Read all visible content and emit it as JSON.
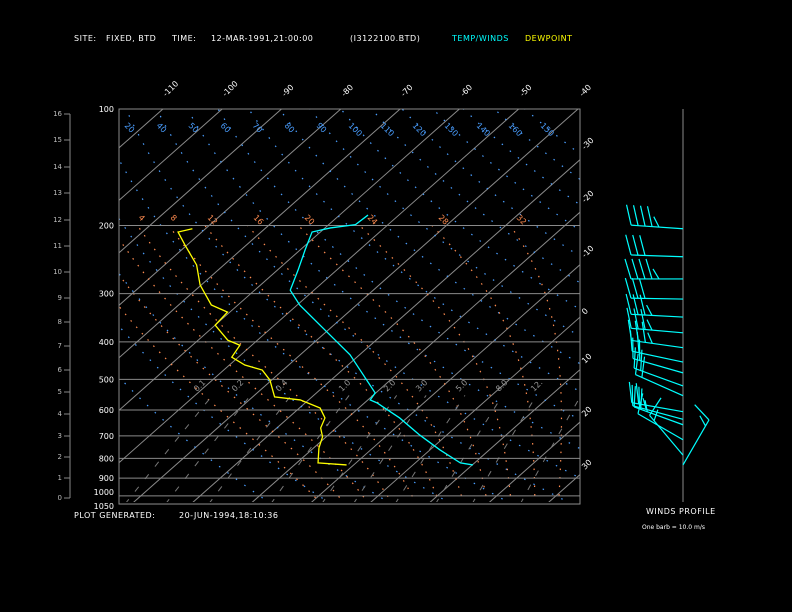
{
  "header": {
    "site_label": "SITE:",
    "site_value": "FIXED, BTD",
    "time_label": "TIME:",
    "time_value": "12-MAR-1991,21:00:00",
    "file_value": "(I3122100.BTD)",
    "legend_temp": "TEMP/WINDS",
    "legend_dew": "DEWPOINT"
  },
  "footer": {
    "generated_label": "PLOT GENERATED:",
    "generated_value": "20-JUN-1994,18:10:36"
  },
  "winds_panel": {
    "title": "WINDS PROFILE",
    "note": "One barb = 10.0 m/s"
  },
  "colors": {
    "temperature": "#00ffff",
    "dewpoint": "#ffff00",
    "dry_adiabat": "#4a9eff",
    "moist_adiabat": "#ff8c50",
    "grid": "#8a8a8a",
    "background": "#000000"
  },
  "chart_data": {
    "type": "line",
    "subtype": "skew-T log-p",
    "pressure_levels": [
      "100",
      "200",
      "300",
      "400",
      "500",
      "600",
      "700",
      "800",
      "900",
      "1000",
      "1050"
    ],
    "pressure_range_hpa": [
      100,
      1050
    ],
    "pressure_scale": "log",
    "height_km_ticks": [
      "0",
      "1",
      "2",
      "3",
      "4",
      "5",
      "6",
      "7",
      "8",
      "9",
      "10",
      "11",
      "12",
      "13",
      "14",
      "15",
      "16"
    ],
    "isotherm_top_labels": [
      "-110",
      "-100",
      "-90",
      "-80",
      "-70",
      "-60",
      "-50",
      "-40"
    ],
    "isotherm_right_labels": [
      "-30",
      "-20",
      "-10",
      "0",
      "10",
      "20",
      "30"
    ],
    "dry_adiabat_labels": [
      "20",
      "40",
      "50",
      "60",
      "70",
      "80",
      "90",
      "100",
      "110",
      "120",
      "130",
      "140",
      "160",
      "150"
    ],
    "moist_adiabat_labels": [
      "4",
      "8",
      "12",
      "16",
      "20",
      "24",
      "28",
      "32"
    ],
    "mixing_ratio_labels": [
      "0.1",
      "0.2",
      "0.4",
      "1.0",
      "2.0",
      "3.0",
      "5.0",
      "8.0",
      "12."
    ],
    "series": [
      {
        "name": "TEMP/WINDS",
        "color": "#00ffff",
        "points": [
          [
            832,
            10.1
          ],
          [
            822,
            7.6
          ],
          [
            761,
            1.7
          ],
          [
            696,
            -4.6
          ],
          [
            629,
            -11.2
          ],
          [
            575,
            -17.9
          ],
          [
            565,
            -19.6
          ],
          [
            542,
            -20.1
          ],
          [
            473,
            -27.0
          ],
          [
            432,
            -31.6
          ],
          [
            373,
            -40.5
          ],
          [
            321,
            -49.6
          ],
          [
            294,
            -54.0
          ],
          [
            261,
            -56.5
          ],
          [
            231,
            -59.2
          ],
          [
            208,
            -61.4
          ],
          [
            203,
            -59.1
          ],
          [
            199,
            -55.5
          ],
          [
            188,
            -55.2
          ]
        ]
      },
      {
        "name": "DEWPOINT",
        "color": "#ffff00",
        "points": [
          [
            832,
            -11.2
          ],
          [
            822,
            -16.4
          ],
          [
            752,
            -19.1
          ],
          [
            704,
            -20.6
          ],
          [
            668,
            -22.6
          ],
          [
            629,
            -23.8
          ],
          [
            593,
            -26.5
          ],
          [
            565,
            -31.4
          ],
          [
            555,
            -36.3
          ],
          [
            502,
            -40.3
          ],
          [
            473,
            -43.5
          ],
          [
            459,
            -47.4
          ],
          [
            438,
            -51.1
          ],
          [
            408,
            -52.0
          ],
          [
            396,
            -55.0
          ],
          [
            362,
            -60.0
          ],
          [
            335,
            -60.4
          ],
          [
            321,
            -64.5
          ],
          [
            285,
            -70.2
          ],
          [
            253,
            -74.6
          ],
          [
            225,
            -80.3
          ],
          [
            208,
            -84.0
          ],
          [
            204,
            -82.2
          ]
        ]
      }
    ],
    "winds": [
      {
        "p": 204,
        "dir": 274,
        "spd": 35
      },
      {
        "p": 241,
        "dir": 272,
        "spd": 30
      },
      {
        "p": 275,
        "dir": 270,
        "spd": 35
      },
      {
        "p": 310,
        "dir": 271,
        "spd": 30
      },
      {
        "p": 345,
        "dir": 273,
        "spd": 25
      },
      {
        "p": 379,
        "dir": 275,
        "spd": 25
      },
      {
        "p": 414,
        "dir": 278,
        "spd": 25
      },
      {
        "p": 451,
        "dir": 282,
        "spd": 20
      },
      {
        "p": 481,
        "dir": 286,
        "spd": 20
      },
      {
        "p": 520,
        "dir": 290,
        "spd": 20
      },
      {
        "p": 551,
        "dir": 294,
        "spd": 20
      },
      {
        "p": 606,
        "dir": 280,
        "spd": 20
      },
      {
        "p": 634,
        "dir": 285,
        "spd": 15
      },
      {
        "p": 655,
        "dir": 290,
        "spd": 15
      },
      {
        "p": 716,
        "dir": 300,
        "spd": 10
      },
      {
        "p": 785,
        "dir": 320,
        "spd": 5
      },
      {
        "p": 832,
        "dir": 30,
        "spd": 5
      }
    ]
  }
}
